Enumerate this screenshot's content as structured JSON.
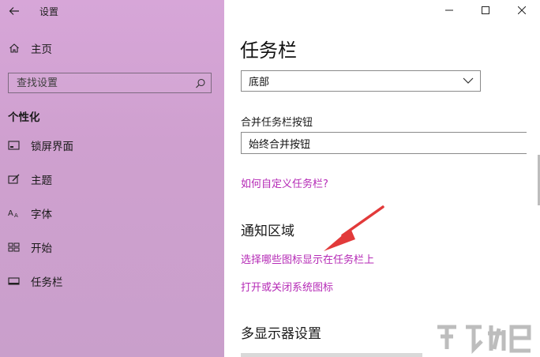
{
  "window": {
    "title": "设置"
  },
  "sidebar": {
    "home_label": "主页",
    "search_placeholder": "查找设置",
    "section_heading": "个性化",
    "items": [
      {
        "label": "锁屏界面",
        "icon": "lock-screen-icon"
      },
      {
        "label": "主题",
        "icon": "theme-icon"
      },
      {
        "label": "字体",
        "icon": "font-icon"
      },
      {
        "label": "开始",
        "icon": "start-icon"
      },
      {
        "label": "任务栏",
        "icon": "taskbar-icon"
      }
    ]
  },
  "main": {
    "page_title": "任务栏",
    "position_select": {
      "value": "底部"
    },
    "combine_label": "合并任务栏按钮",
    "combine_select": {
      "value": "始终合并按钮"
    },
    "customize_link": "如何自定义任务栏?",
    "notification_section": "通知区域",
    "select_icons_link": "选择哪些图标显示在任务栏上",
    "system_icons_link": "打开或关闭系统图标",
    "multi_display_section": "多显示器设置"
  },
  "colors": {
    "sidebar_bg": "#cfa0cf",
    "link": "#b52ab6",
    "arrow": "#e23a3a"
  }
}
